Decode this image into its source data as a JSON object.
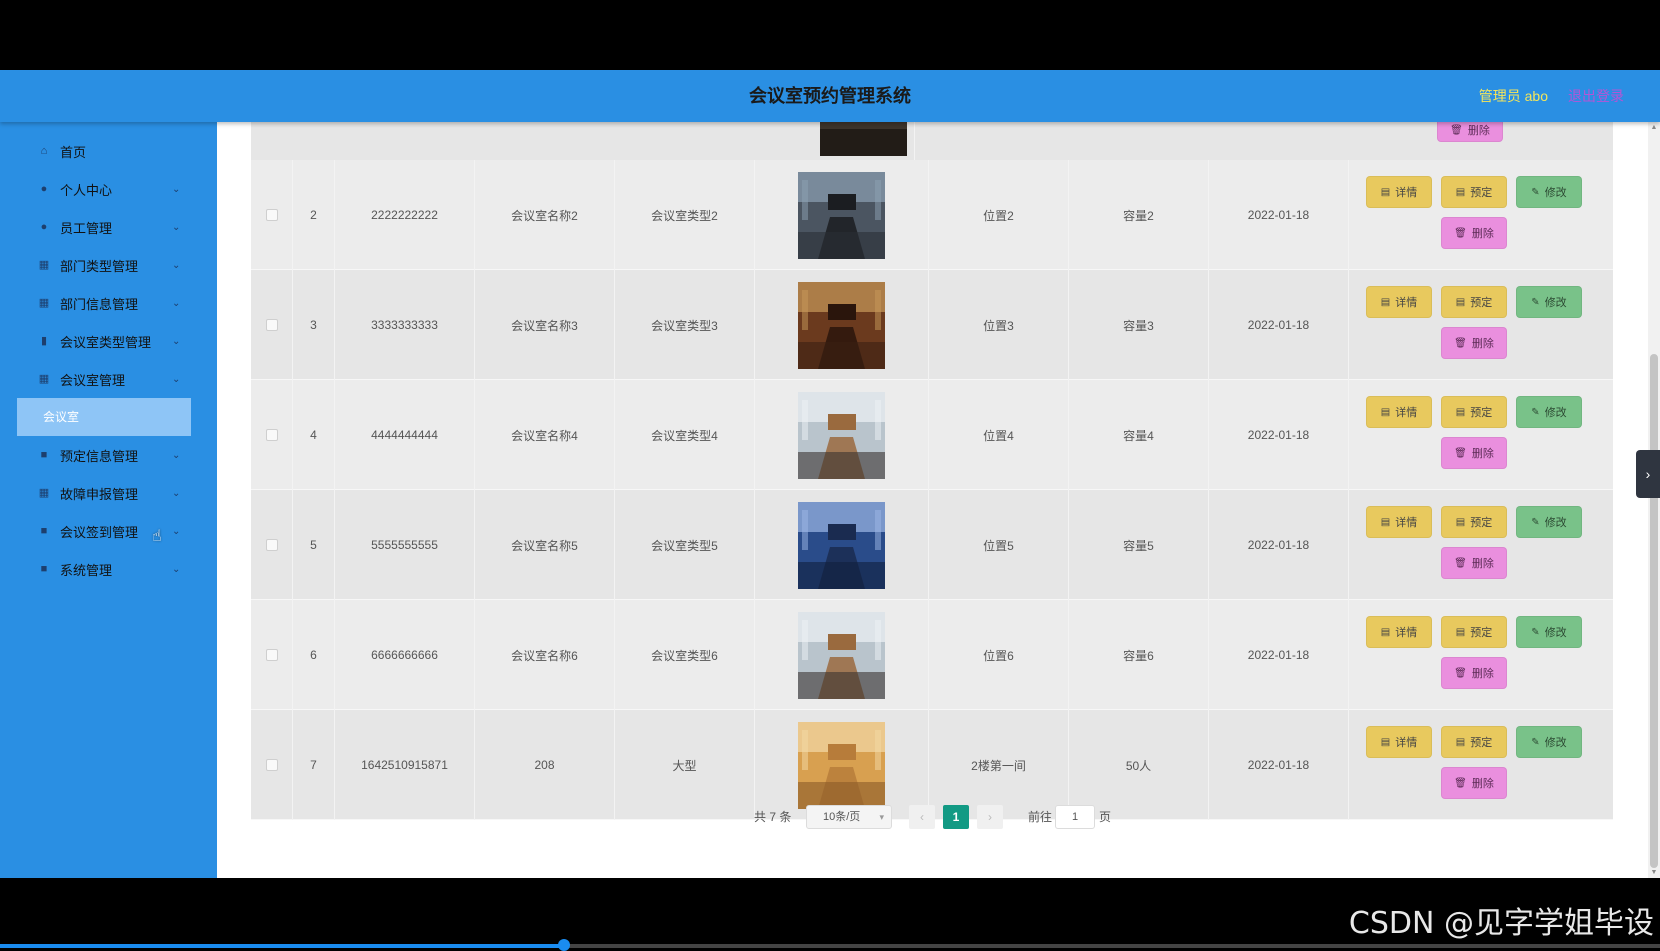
{
  "header": {
    "title": "会议室预约管理系统",
    "admin": "管理员 abo",
    "logout": "退出登录"
  },
  "sidebar": {
    "items": [
      {
        "label": "首页",
        "icon": "home-icon",
        "glyph": "⌂",
        "arrow": false
      },
      {
        "label": "个人中心",
        "icon": "user-icon",
        "glyph": "●",
        "arrow": true
      },
      {
        "label": "员工管理",
        "icon": "user-icon",
        "glyph": "●",
        "arrow": true
      },
      {
        "label": "部门类型管理",
        "icon": "grid-icon",
        "glyph": "▦",
        "arrow": true
      },
      {
        "label": "部门信息管理",
        "icon": "grid-icon",
        "glyph": "▦",
        "arrow": true
      },
      {
        "label": "会议室类型管理",
        "icon": "bar-chart-icon",
        "glyph": "▮",
        "arrow": true
      },
      {
        "label": "会议室管理",
        "icon": "grid-icon",
        "glyph": "▦",
        "arrow": true
      },
      {
        "label": "预定信息管理",
        "icon": "message-icon",
        "glyph": "■",
        "arrow": true
      },
      {
        "label": "故障申报管理",
        "icon": "grid-icon",
        "glyph": "▦",
        "arrow": true
      },
      {
        "label": "会议签到管理",
        "icon": "briefcase-icon",
        "glyph": "■",
        "arrow": true
      },
      {
        "label": "系统管理",
        "icon": "monitor-icon",
        "glyph": "■",
        "arrow": true
      }
    ],
    "active_sub": "会议室",
    "arrow_glyph": "⌄"
  },
  "buttons": {
    "detail": "详情",
    "book": "预定",
    "edit": "修改",
    "delete": "删除"
  },
  "rows": [
    {
      "index": "2",
      "code": "2222222222",
      "name": "会议室名称2",
      "type": "会议室类型2",
      "image": "dark",
      "location": "位置2",
      "capacity": "容量2",
      "date": "2022-01-18"
    },
    {
      "index": "3",
      "code": "3333333333",
      "name": "会议室名称3",
      "type": "会议室类型3",
      "image": "wood",
      "location": "位置3",
      "capacity": "容量3",
      "date": "2022-01-18"
    },
    {
      "index": "4",
      "code": "4444444444",
      "name": "会议室名称4",
      "type": "会议室类型4",
      "image": "bright",
      "location": "位置4",
      "capacity": "容量4",
      "date": "2022-01-18"
    },
    {
      "index": "5",
      "code": "5555555555",
      "name": "会议室名称5",
      "type": "会议室类型5",
      "image": "blue",
      "location": "位置5",
      "capacity": "容量5",
      "date": "2022-01-18"
    },
    {
      "index": "6",
      "code": "6666666666",
      "name": "会议室名称6",
      "type": "会议室类型6",
      "image": "bright",
      "location": "位置6",
      "capacity": "容量6",
      "date": "2022-01-18"
    },
    {
      "index": "7",
      "code": "1642510915871",
      "name": "208",
      "type": "大型",
      "image": "orange",
      "location": "2楼第一间",
      "capacity": "50人",
      "date": "2022-01-18"
    }
  ],
  "pagination": {
    "total": "共 7 条",
    "page_size": "10条/页",
    "current_page": "1",
    "goto_label": "前往",
    "goto_value": "1",
    "page_word": "页"
  },
  "watermark": "CSDN @见字学姐毕设",
  "video_progress": 0.34,
  "colors": {
    "header_bg": "#2a8fe3",
    "sidebar_bg": "#2a8fe3",
    "active_sub_bg": "#8ec5f6",
    "btn_yellow": "#e8c95e",
    "btn_green": "#79c289",
    "btn_pink": "#ea8fde",
    "page_active": "#129a84"
  }
}
